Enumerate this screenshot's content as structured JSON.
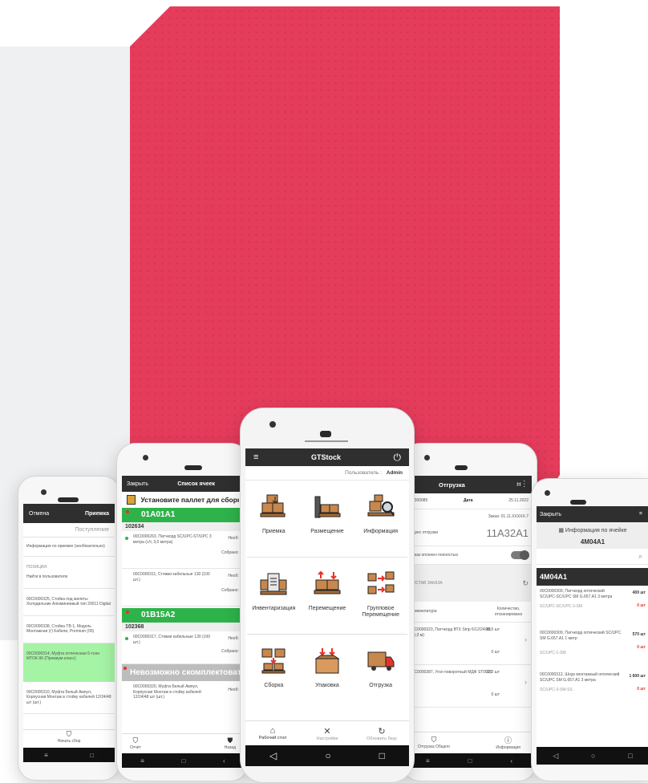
{
  "colors": {
    "accent_red": "#e63c5c",
    "header_dark": "#2f2f2f",
    "ok_green": "#2eb34a",
    "warn_red": "#e5332a",
    "highlight_green": "#a5f3a5"
  },
  "p1": {
    "cancel": "Отмена",
    "title": "Приемка",
    "subtitle": "Поступление",
    "input_placeholder": "Информация по приемке (необязательно)",
    "section": "ПОЗИЦИИ:",
    "search_hint": "Найти в пользователе",
    "items": [
      "00С0000325, Стойка под жилеты Холодильник Алюминиевый тип 20011 Digital",
      "00С0000338, Стойка ТВ-1, Модель Монтажная (г) Кабели, Premium (00)",
      "00С0000314, Муфта оптическая 6-тонн МТОК-96 (Премиум-класс)",
      "00С0000310, Муфта Белый Ампул, Корпусная Монтаж в стойку кабелей 12/24/48 шт (шт.)"
    ],
    "footer": "Начать сбор"
  },
  "p2": {
    "close": "Закрыть",
    "title": "Список ячеек",
    "banner": "Установите паллет для сборки",
    "cells": [
      {
        "code": "01А01А1",
        "order": "102634",
        "items": [
          {
            "text": "00С0000263, Патчкорд SC/UPC-ST/UPC 3 метра (с/т, 3,0 метра)",
            "qty": "Необ: 3",
            "done": "Собрано: 3"
          },
          {
            "text": "00С0000311, Стяжки кабельные 130 (100 шт.)",
            "qty": "Необ: 3",
            "done": "Собрано: 3"
          }
        ]
      },
      {
        "code": "01В15А2",
        "order": "102368",
        "items": [
          {
            "text": "00С0000317, Стяжки кабельные 130 (100 шт.)",
            "qty": "Необ: 3",
            "done": "Собрано: 3"
          }
        ]
      }
    ],
    "failed": "Невозможно скомплектовать",
    "failed_item": {
      "text": "00С0000320, Муфта Белый Ампул, Корпусная Монтаж в стойку кабелей 12/24/48 шт (шт.)",
      "qty": "Необ: 4"
    },
    "nav": [
      "Отчёт",
      "Назад"
    ]
  },
  "p3": {
    "title": "GTStock",
    "user_label": "Пользователь :",
    "user": "Admin",
    "tiles": [
      "Приемка",
      "Размещение",
      "Информация",
      "Инвентаризация",
      "Перемещение",
      "Групповое Перемещение",
      "Сборка",
      "Упаковка",
      "Отгрузка"
    ],
    "nav": [
      "Рабочий стол",
      "Настройки",
      "Обновить базу"
    ]
  },
  "p4": {
    "title": "Отгрузка",
    "num_label": "00000085",
    "date_label": "Дата",
    "date": "25.11.2022",
    "order_label": "Заказ: 01.11.XXXXX.7",
    "addr_label": "Адрес отгрузки",
    "cell": "11А32А1",
    "switch_label": "Заказ оплачен полностью",
    "section": "СОСТАВ ЗАКАЗА",
    "col1": "Номенклатура",
    "col2": "Количество, отсканировано",
    "items": [
      {
        "text": "00С0000323, Патчкорд ВТХ Strip 6/12/24/48 (25,0 м)",
        "qty": "10,0 шт",
        "scan": "0 шт"
      },
      {
        "text": "00С0000387, Угол поворотный МДФ ST0000",
        "qty": "12,0 шт",
        "scan": "0 шт"
      }
    ],
    "nav": [
      "Отгрузка Общего",
      "Информация"
    ]
  },
  "p5": {
    "close": "Закрыть",
    "title": "Информация по ячейке",
    "cell": "4М04А1",
    "header": "4М04А1",
    "items": [
      {
        "text": "00С0000309, Патчкорд оптический SC/UPC-SC/UPC SM G.657.A1 3 метра",
        "code": "SC/UPC-SC/UPC-3-SM",
        "qty": "400 шт",
        "res": "0 шт"
      },
      {
        "text": "00С0000309, Патчкорд оптический SC/UPC SM G.657.A1 1 метр",
        "code": "SC/UPC-1-SM",
        "qty": "570 шт",
        "res": "0 шт"
      },
      {
        "text": "00С0000312, Шнур монтажный оптический SC/UPC SM G.657.A1 3 метра",
        "code": "SC/UPC-3-SM-SS",
        "qty": "1 600 шт",
        "res": "0 шт"
      }
    ]
  }
}
